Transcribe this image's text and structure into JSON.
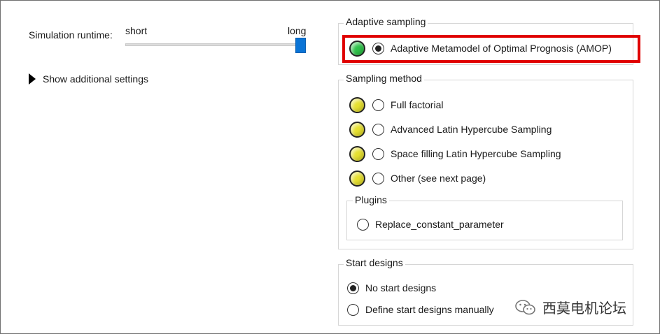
{
  "runtime": {
    "label": "Simulation runtime:",
    "min_label": "short",
    "max_label": "long",
    "value_fraction": 1.0
  },
  "additional_settings": {
    "label": "Show additional settings"
  },
  "adaptive_sampling": {
    "title": "Adaptive sampling",
    "option": {
      "label": "Adaptive Metamodel of Optimal Prognosis (AMOP)",
      "status": "green",
      "checked": true
    }
  },
  "sampling_method": {
    "title": "Sampling method",
    "options": [
      {
        "label": "Full factorial",
        "status": "yellow",
        "checked": false
      },
      {
        "label": "Advanced Latin Hypercube Sampling",
        "status": "yellow",
        "checked": false
      },
      {
        "label": "Space filling Latin Hypercube Sampling",
        "status": "yellow",
        "checked": false
      },
      {
        "label": "Other (see next page)",
        "status": "yellow",
        "checked": false
      }
    ],
    "plugins": {
      "title": "Plugins",
      "options": [
        {
          "label": "Replace_constant_parameter",
          "checked": false
        }
      ]
    }
  },
  "start_designs": {
    "title": "Start designs",
    "options": [
      {
        "label": "No start designs",
        "checked": true
      },
      {
        "label": "Define start designs manually",
        "checked": false
      }
    ]
  },
  "watermark": {
    "text": "西莫电机论坛"
  },
  "colors": {
    "highlight": "#e00000",
    "slider": "#0a74d6",
    "led_green": "#2fc24a",
    "led_yellow": "#e6e030"
  }
}
